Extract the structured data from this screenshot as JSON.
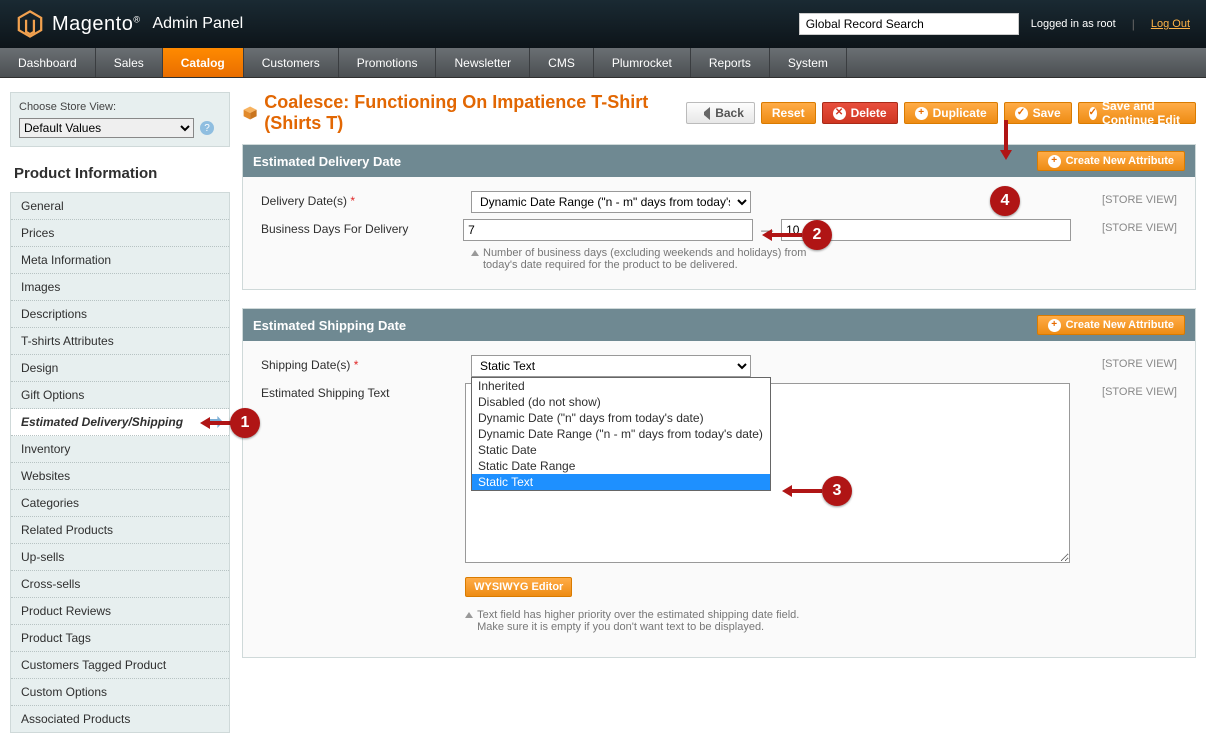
{
  "header": {
    "brand": "Magento",
    "brand_sub": "Admin Panel",
    "search_value": "Global Record Search",
    "logged_in": "Logged in as root",
    "logout": "Log Out"
  },
  "nav": [
    "Dashboard",
    "Sales",
    "Catalog",
    "Customers",
    "Promotions",
    "Newsletter",
    "CMS",
    "Plumrocket",
    "Reports",
    "System"
  ],
  "nav_active": 2,
  "sidebar": {
    "store_view_label": "Choose Store View:",
    "store_view_value": "Default Values",
    "heading": "Product Information",
    "items": [
      "General",
      "Prices",
      "Meta Information",
      "Images",
      "Descriptions",
      "T-shirts Attributes",
      "Design",
      "Gift Options",
      "Estimated Delivery/Shipping",
      "Inventory",
      "Websites",
      "Categories",
      "Related Products",
      "Up-sells",
      "Cross-sells",
      "Product Reviews",
      "Product Tags",
      "Customers Tagged Product",
      "Custom Options",
      "Associated Products"
    ],
    "active": 8
  },
  "page": {
    "title": "Coalesce: Functioning On Impatience T-Shirt (Shirts T)",
    "actions": {
      "back": "Back",
      "reset": "Reset",
      "delete": "Delete",
      "duplicate": "Duplicate",
      "save": "Save",
      "save_continue": "Save and Continue Edit"
    }
  },
  "sections": {
    "delivery": {
      "title": "Estimated Delivery Date",
      "new_attr": "Create New Attribute",
      "rows": {
        "dates_label": "Delivery Date(s)",
        "dates_value": "Dynamic Date Range (\"n - m\" days from today's",
        "biz_label": "Business Days For Delivery",
        "biz_from": "7",
        "biz_to": "10",
        "hint": "Number of business days (excluding weekends and holidays) from today's date required for the product to be delivered."
      },
      "scope": "[STORE VIEW]"
    },
    "shipping": {
      "title": "Estimated Shipping Date",
      "new_attr": "Create New Attribute",
      "rows": {
        "dates_label": "Shipping Date(s)",
        "dates_value": "Static Text",
        "text_label": "Estimated Shipping Text",
        "wysiwyg": "WYSIWYG Editor",
        "hint": "Text field has higher priority over the estimated shipping date field. Make sure it is empty if you don't want text to be displayed."
      },
      "scope": "[STORE VIEW]",
      "dropdown_options": [
        "Inherited",
        "Disabled (do not show)",
        "Dynamic Date (\"n\" days from today's date)",
        "Dynamic Date Range (\"n - m\" days from today's date)",
        "Static Date",
        "Static Date Range",
        "Static Text"
      ],
      "dropdown_selected": 6
    }
  },
  "callouts": {
    "c1": "1",
    "c2": "2",
    "c3": "3",
    "c4": "4"
  }
}
